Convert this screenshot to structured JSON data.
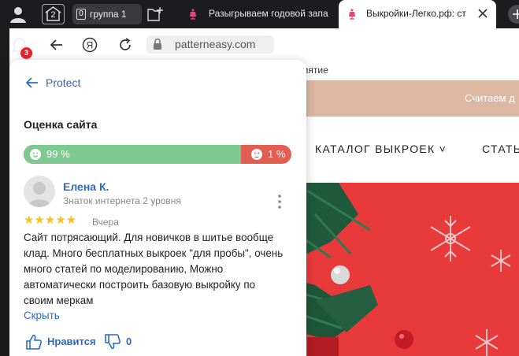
{
  "browser": {
    "tabs_count": "2",
    "group": {
      "count": "0",
      "label": "группа 1"
    },
    "tabs": [
      {
        "title": "Разыгрываем годовой запа"
      },
      {
        "title": "Выкройки-Легко.рф: ст"
      }
    ],
    "notifications_badge": "3",
    "url": "patterneasy.com"
  },
  "site": {
    "bookmark_fragment": "риятие",
    "promo_text": "Считаем д",
    "nav": [
      {
        "label": "КАТАЛОГ ВЫКРОЕК ˅"
      },
      {
        "label": "СТАТЬ"
      }
    ]
  },
  "protect": {
    "back_label": "Protect",
    "rating_title": "Оценка сайта",
    "positive_percent": 99,
    "positive_label": "99 %",
    "negative_label": "1 %",
    "review": {
      "author": "Елена К.",
      "level": "Знаток интернета 2 уровня",
      "stars": 5,
      "stars_text": "★★★★★",
      "date": "Вчера",
      "text": "Сайт потрясающий. Для новичков в шитье вообще клад. Много бесплатных выкроек \"для пробы\", очень много статей по моделированию, Можно автоматически построить базовую выкройку по своим меркам",
      "collapse_label": "Скрыть",
      "like_label": "Нравится",
      "dislike_count": "0"
    }
  },
  "colors": {
    "accent": "#2a6ac4",
    "positive": "#7ec892",
    "negative": "#e25d52",
    "star": "#ffbf1f",
    "promo": "#dcb7a2",
    "hero": "#e8393b"
  }
}
